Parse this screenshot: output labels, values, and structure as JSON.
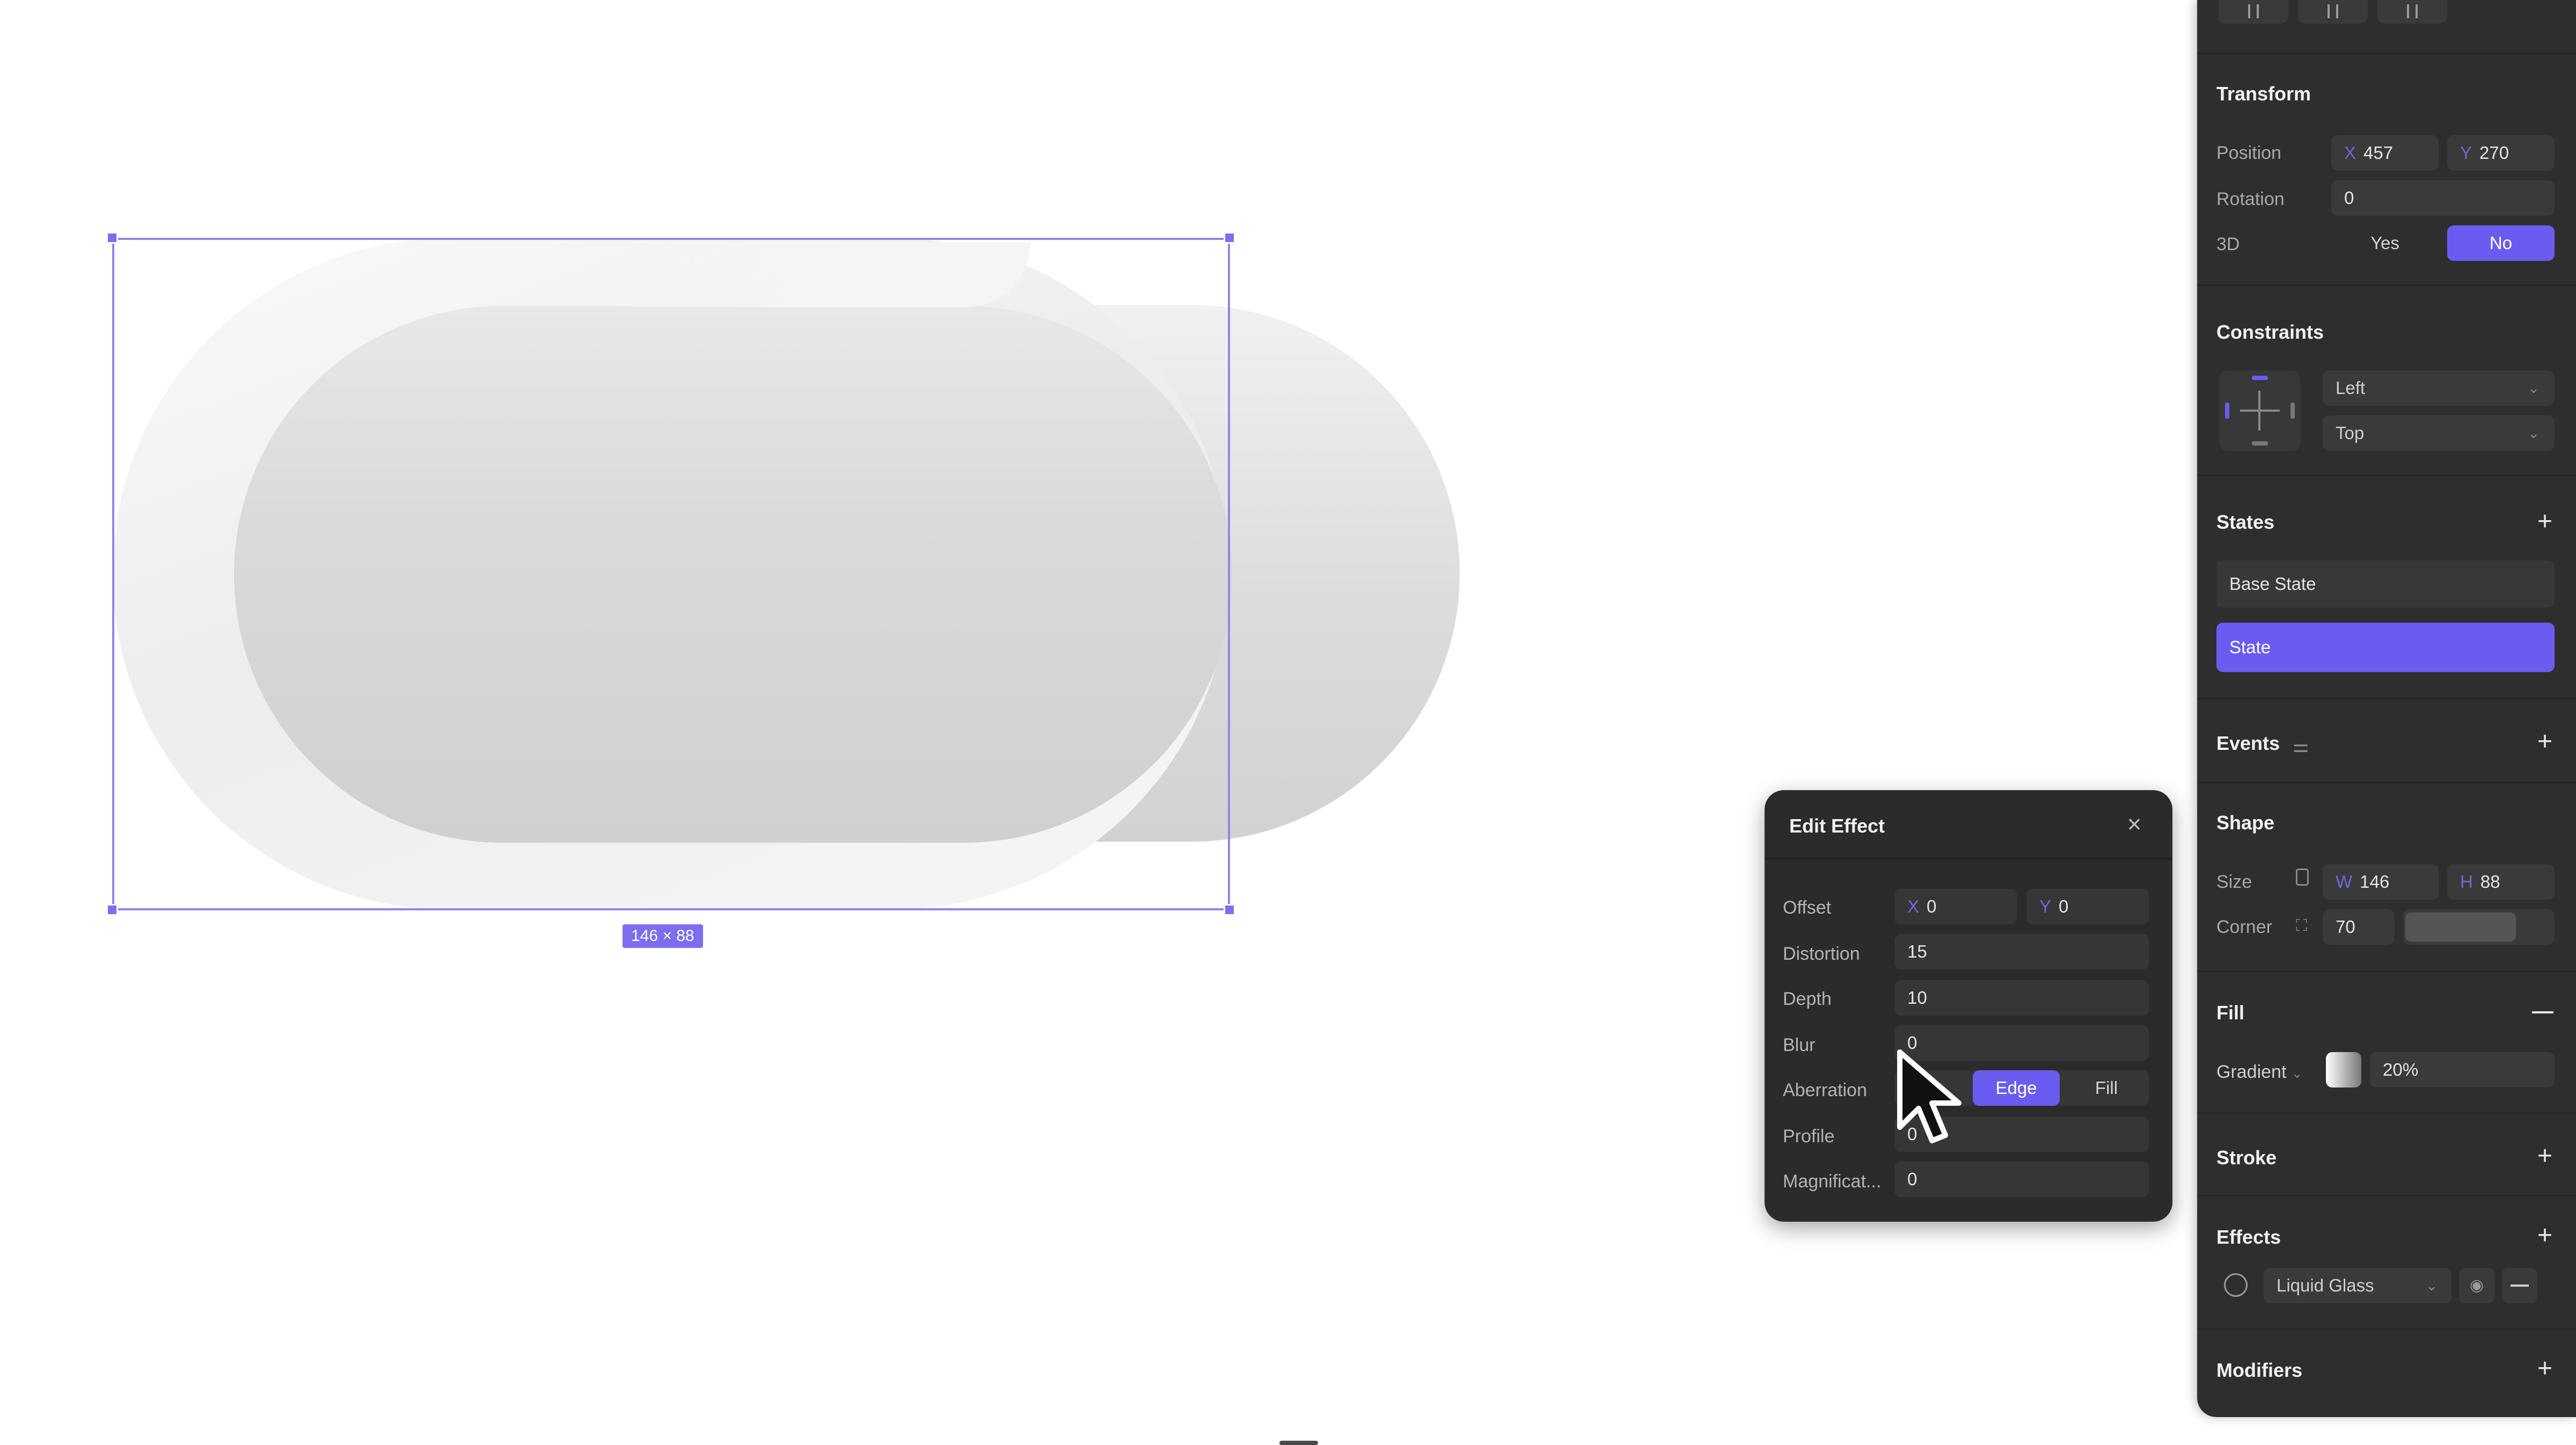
{
  "canvas": {
    "selection_size_label": "146 × 88"
  },
  "panel": {
    "transform": {
      "title": "Transform",
      "position_label": "Position",
      "x_axis": "X",
      "x_value": "457",
      "y_axis": "Y",
      "y_value": "270",
      "rotation_label": "Rotation",
      "rotation_value": "0",
      "threed_label": "3D",
      "yes_label": "Yes",
      "no_label": "No"
    },
    "constraints": {
      "title": "Constraints",
      "horizontal": "Left",
      "vertical": "Top"
    },
    "states": {
      "title": "States",
      "items": [
        "Base State",
        "State"
      ]
    },
    "events": {
      "title": "Events"
    },
    "shape": {
      "title": "Shape",
      "size_label": "Size",
      "w_axis": "W",
      "w_value": "146",
      "h_axis": "H",
      "h_value": "88",
      "corner_label": "Corner",
      "corner_value": "70"
    },
    "fill": {
      "title": "Fill",
      "type_label": "Gradient",
      "opacity": "20%"
    },
    "stroke": {
      "title": "Stroke"
    },
    "effects": {
      "title": "Effects",
      "effect_name": "Liquid Glass"
    },
    "modifiers": {
      "title": "Modifiers"
    }
  },
  "edit_effect": {
    "title": "Edit Effect",
    "offset_label": "Offset",
    "offset_x_axis": "X",
    "offset_x": "0",
    "offset_y_axis": "Y",
    "offset_y": "0",
    "distortion_label": "Distortion",
    "distortion": "15",
    "depth_label": "Depth",
    "depth": "10",
    "blur_label": "Blur",
    "blur": "0",
    "aberration_label": "Aberration",
    "aberration_edge": "Edge",
    "aberration_fill": "Fill",
    "profile_label": "Profile",
    "profile": "0",
    "magnification_label": "Magnificat...",
    "magnification": "0"
  },
  "colors": {
    "accent": "#6a5cf0",
    "panel_bg": "#2e2e2e",
    "selection": "#8f86ea"
  }
}
